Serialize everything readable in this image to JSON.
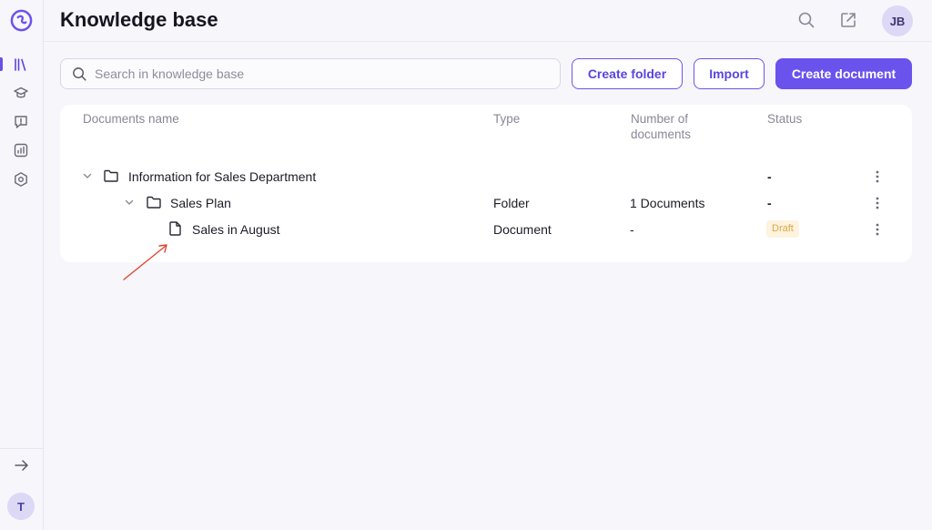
{
  "app": {
    "title": "Knowledge base"
  },
  "sidebar": {
    "items": [
      {
        "name": "library-icon",
        "active": true
      },
      {
        "name": "graduation-cap-icon",
        "active": false
      },
      {
        "name": "chat-alert-icon",
        "active": false
      },
      {
        "name": "analytics-icon",
        "active": false
      },
      {
        "name": "settings-icon",
        "active": false
      }
    ],
    "user_initial": "T"
  },
  "header": {
    "user_initials": "JB"
  },
  "toolbar": {
    "search_placeholder": "Search in knowledge base",
    "create_folder_label": "Create folder",
    "import_label": "Import",
    "create_document_label": "Create document"
  },
  "table": {
    "headers": {
      "name": "Documents name",
      "type": "Type",
      "count": "Number of documents",
      "status": "Status"
    },
    "rows": [
      {
        "name": "Information for Sales Department",
        "type": "",
        "count": "",
        "status": "-",
        "kind": "folder"
      },
      {
        "name": "Sales Plan",
        "type": "Folder",
        "count": "1 Documents",
        "status": "-",
        "kind": "folder"
      },
      {
        "name": "Sales in August",
        "type": "Document",
        "count": "-",
        "status": "Draft",
        "kind": "document"
      }
    ]
  },
  "colors": {
    "accent": "#6a52ec",
    "draft_bg": "#fdf3de",
    "draft_text": "#e0a64a",
    "annotation": "#e0452f"
  }
}
